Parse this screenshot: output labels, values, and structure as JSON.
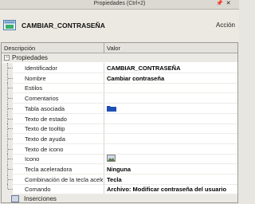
{
  "window": {
    "title": "Propiedades (Ctrl+2)"
  },
  "header": {
    "object_name": "CAMBIAR_CONTRASEÑA",
    "action_label": "Acción"
  },
  "grid": {
    "columns": {
      "description": "Descripción",
      "value": "Valor"
    },
    "category": {
      "label": "Propiedades",
      "toggle": "−"
    },
    "rows": [
      {
        "name": "Identificador",
        "value": "CAMBIAR_CONTRASEÑA"
      },
      {
        "name": "Nombre",
        "value": "Cambiar contraseña"
      },
      {
        "name": "Estilos",
        "value": ""
      },
      {
        "name": "Comentarios",
        "value": ""
      },
      {
        "name": "Tabla asociada",
        "value": "",
        "icon": "folder-icon"
      },
      {
        "name": "Texto de estado",
        "value": ""
      },
      {
        "name": "Texto de tooltip",
        "value": ""
      },
      {
        "name": "Texto de ayuda",
        "value": ""
      },
      {
        "name": "Texto de icono",
        "value": ""
      },
      {
        "name": "Icono",
        "value": "",
        "icon": "image-picker-icon"
      },
      {
        "name": "Tecla aceleradora",
        "value": "Ninguna"
      },
      {
        "name": "Combinación de la tecla acele…",
        "value": "Tecla"
      },
      {
        "name": "Comando",
        "value": "Archivo: Modificar contraseña del usuario"
      }
    ],
    "insertions": {
      "label": "Inserciones"
    }
  },
  "colors": {
    "folder": "#1e4fb4",
    "header_bg": "#ece9e2",
    "category_bg": "#ebe9e3"
  }
}
